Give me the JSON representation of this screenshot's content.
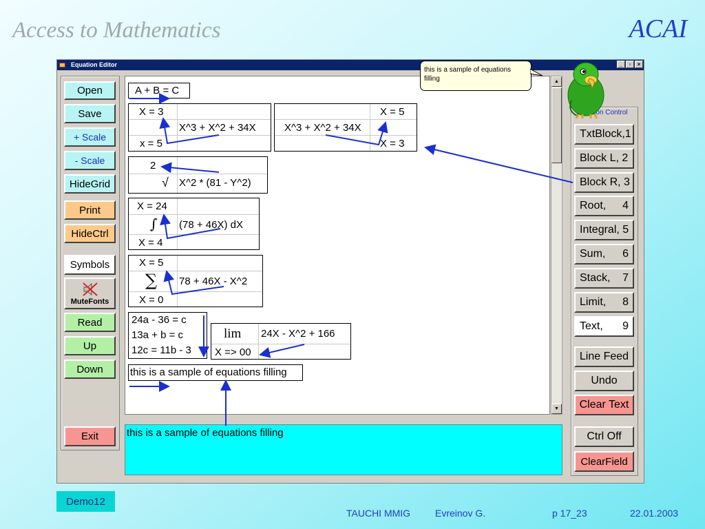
{
  "slide": {
    "title": "Access to Mathematics",
    "brand": "ACAI"
  },
  "window": {
    "title": "Equation Editor",
    "min": "_",
    "max": "×",
    "restore": "▫",
    "close": "×"
  },
  "left_buttons": {
    "open": "Open",
    "save": "Save",
    "scale_up": "+ Scale",
    "scale_down": "- Scale",
    "hide_grid": "HideGrid",
    "print": "Print",
    "hide_ctrl": "HideCtrl",
    "symbols": "Symbols",
    "mute_fonts": "MuteFonts",
    "read": "Read",
    "up": "Up",
    "down": "Down",
    "exit": "Exit"
  },
  "tooltip": "this is a sample of equations filling",
  "equation_control_label": "Equation Control",
  "right_buttons": [
    {
      "label": "TxtBlock,1"
    },
    {
      "label": "Block L, 2"
    },
    {
      "label": "Block R, 3"
    },
    {
      "name": "Root,",
      "num": "4"
    },
    {
      "label": "Integral, 5"
    },
    {
      "name": "Sum,",
      "num": "6"
    },
    {
      "name": "Stack,",
      "num": "7"
    },
    {
      "name": "Limit,",
      "num": "8"
    },
    {
      "name": "Text,",
      "num": "9"
    }
  ],
  "bottom_right_buttons": {
    "line_feed": "Line Feed",
    "undo": "Undo",
    "clear_text": "Clear Text",
    "ctrl_off": "Ctrl Off",
    "clear_field": "ClearField"
  },
  "equations": {
    "e1": "A + B = C",
    "left_upper": "X = 3",
    "left_expr": "X^3 + X^2 + 34X",
    "left_lower": "x = 5",
    "right_expr": "X^3 + X^2 + 34X",
    "right_upper": "X = 5",
    "right_lower": "X = 3",
    "root_index": "2",
    "root_sign": "√",
    "root_expr": "X^2 * (81 - Y^2)",
    "int_upper": "X = 24",
    "int_sign": "∫",
    "int_expr": "(78 + 46X) dX",
    "int_lower": "X = 4",
    "sum_upper": "X = 5",
    "sum_sign": "∑",
    "sum_expr": "78 + 46X - X^2",
    "sum_lower": "X = 0",
    "stack_1": "24a - 36 = c",
    "stack_2": "13a + b = c",
    "stack_3": "12c = 11b - 3",
    "lim_word": "lim",
    "lim_expr": "24X - X^2 + 166",
    "lim_sub": "X => 00",
    "text_block": "this is a sample of equations filling"
  },
  "text_field": "this is a sample of equations filling",
  "footer": {
    "demo": "Demo12",
    "org": "TAUCHI MMIG",
    "author": "Evreinov G.",
    "page": "p 17_23",
    "date": "22.01.2003"
  },
  "colors": {
    "arrow": "#1a2fd0",
    "parrot": "#2faa1c",
    "selection": "#00ffff"
  }
}
